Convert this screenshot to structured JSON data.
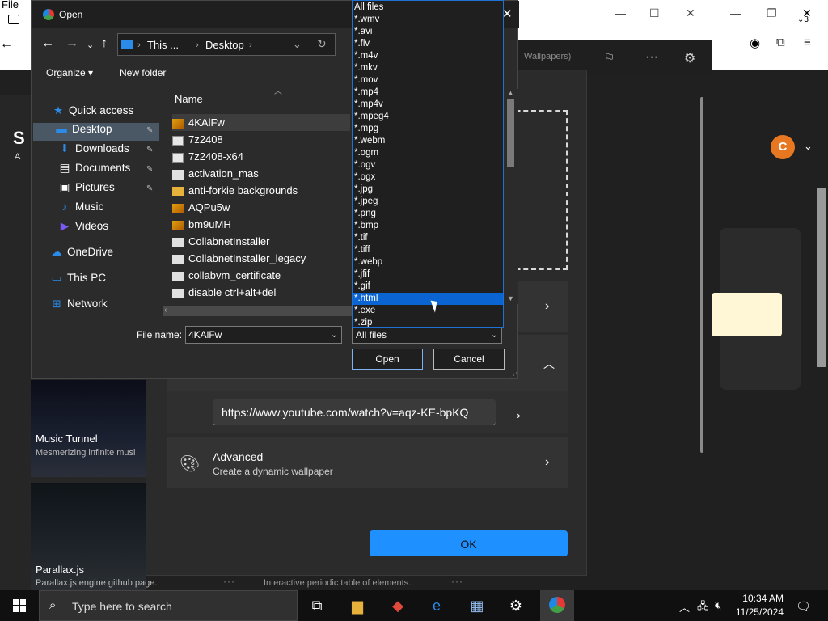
{
  "browser": {
    "menu_file": "File",
    "tab_count": "3"
  },
  "background_app": {
    "wallpapers_hint": "Wallpapers)",
    "avatar_letter": "C",
    "gallery_letter_s": "S",
    "gallery_letter_a": "A",
    "tiles": [
      {
        "title": "Music Tunnel",
        "subtitle": "Mesmerizing infinite musi"
      },
      {
        "title": "Parallax.js",
        "subtitle": "Parallax.js engine github page."
      }
    ],
    "tile3_caption": "Interactive periodic table of elements.",
    "url_value": "https://www.youtube.com/watch?v=aqz-KE-bpKQ",
    "advanced_title": "Advanced",
    "advanced_subtitle": "Create a dynamic wallpaper",
    "ok_label": "OK"
  },
  "open_dialog": {
    "title": "Open",
    "breadcrumb": [
      "This ...",
      "Desktop"
    ],
    "organize_label": "Organize",
    "new_folder_label": "New folder",
    "nav_items": [
      {
        "label": "Quick access",
        "icon": "star-icon"
      },
      {
        "label": "Desktop",
        "icon": "desktop-icon",
        "pinned": true,
        "selected": true
      },
      {
        "label": "Downloads",
        "icon": "download-icon",
        "pinned": true
      },
      {
        "label": "Documents",
        "icon": "document-icon",
        "pinned": true
      },
      {
        "label": "Pictures",
        "icon": "picture-icon",
        "pinned": true
      },
      {
        "label": "Music",
        "icon": "music-icon"
      },
      {
        "label": "Videos",
        "icon": "video-icon"
      },
      {
        "label": "OneDrive",
        "icon": "cloud-icon"
      },
      {
        "label": "This PC",
        "icon": "computer-icon"
      },
      {
        "label": "Network",
        "icon": "network-icon"
      }
    ],
    "column_name": "Name",
    "files": [
      {
        "name": "4KAlFw",
        "icon": "img",
        "selected": true
      },
      {
        "name": "7z2408",
        "icon": "exe"
      },
      {
        "name": "7z2408-x64",
        "icon": "exe"
      },
      {
        "name": "activation_mas",
        "icon": "doc"
      },
      {
        "name": "anti-forkie backgrounds",
        "icon": "fold"
      },
      {
        "name": "AQPu5w",
        "icon": "img"
      },
      {
        "name": "bm9uMH",
        "icon": "img"
      },
      {
        "name": "CollabnetInstaller",
        "icon": "doc"
      },
      {
        "name": "CollabnetInstaller_legacy",
        "icon": "doc"
      },
      {
        "name": "collabvm_certificate",
        "icon": "doc"
      },
      {
        "name": "disable ctrl+alt+del",
        "icon": "doc"
      }
    ],
    "file_name_label": "File name:",
    "file_name_value": "4KAlFw",
    "filter_value": "All files",
    "open_label": "Open",
    "cancel_label": "Cancel",
    "filter_options": [
      "All files",
      "*.wmv",
      "*.avi",
      "*.flv",
      "*.m4v",
      "*.mkv",
      "*.mov",
      "*.mp4",
      "*.mp4v",
      "*.mpeg4",
      "*.mpg",
      "*.webm",
      "*.ogm",
      "*.ogv",
      "*.ogx",
      "*.jpg",
      "*.jpeg",
      "*.png",
      "*.bmp",
      "*.tif",
      "*.tiff",
      "*.webp",
      "*.jfif",
      "*.gif",
      "*.html",
      "*.exe",
      "*.zip"
    ],
    "highlighted_option": "*.html"
  },
  "taskbar": {
    "search_placeholder": "Type here to search",
    "time": "10:34 AM",
    "date": "11/25/2024"
  },
  "colors": {
    "accent": "#1e90ff",
    "highlight": "#0a64d2",
    "avatar": "#e87722"
  }
}
